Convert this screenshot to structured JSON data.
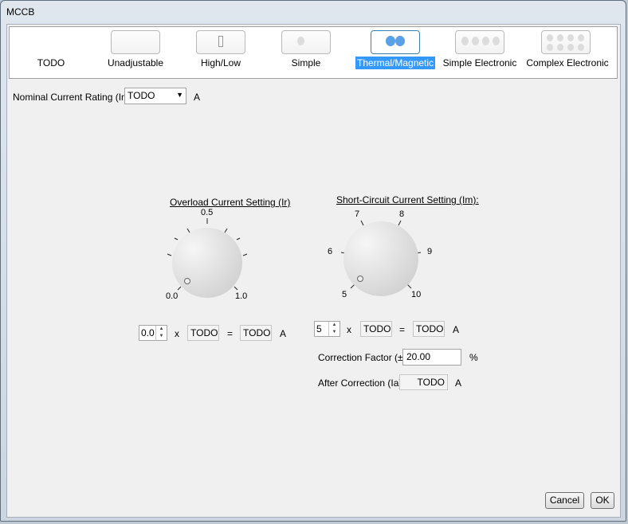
{
  "window": {
    "title": "MCCB"
  },
  "device_types": [
    {
      "label": "TODO",
      "selected": false
    },
    {
      "label": "Unadjustable",
      "selected": false
    },
    {
      "label": "High/Low",
      "selected": false
    },
    {
      "label": "Simple",
      "selected": false
    },
    {
      "label": "Thermal/Magnetic",
      "selected": true
    },
    {
      "label": "Simple Electronic",
      "selected": false
    },
    {
      "label": "Complex Electronic",
      "selected": false
    }
  ],
  "nominal": {
    "label": "Nominal Current Rating (In):",
    "value": "TODO",
    "unit": "A"
  },
  "overload": {
    "title": "Overload Current Setting (Ir)",
    "dial_labels": {
      "top": "0.5",
      "min": "0.0",
      "max": "1.0"
    },
    "multiplier": "0.0",
    "times": "x",
    "base": "TODO",
    "equals": "=",
    "result": "TODO",
    "unit": "A"
  },
  "short_circuit": {
    "title": "Short-Circuit Current Setting (Im):",
    "dial_labels": [
      "5",
      "6",
      "7",
      "8",
      "9",
      "10"
    ],
    "multiplier": "5",
    "times": "x",
    "base": "TODO",
    "equals": "=",
    "result": "TODO",
    "unit": "A"
  },
  "correction": {
    "label": "Correction Factor (±):",
    "value": "20.00",
    "unit": "%"
  },
  "after_correction": {
    "label": "After Correction (Ia):",
    "value": "TODO",
    "unit": "A"
  },
  "buttons": {
    "cancel": "Cancel",
    "ok": "OK"
  },
  "colors": {
    "selection": "#3399ff",
    "accent_dot": "#5aa0e6"
  }
}
